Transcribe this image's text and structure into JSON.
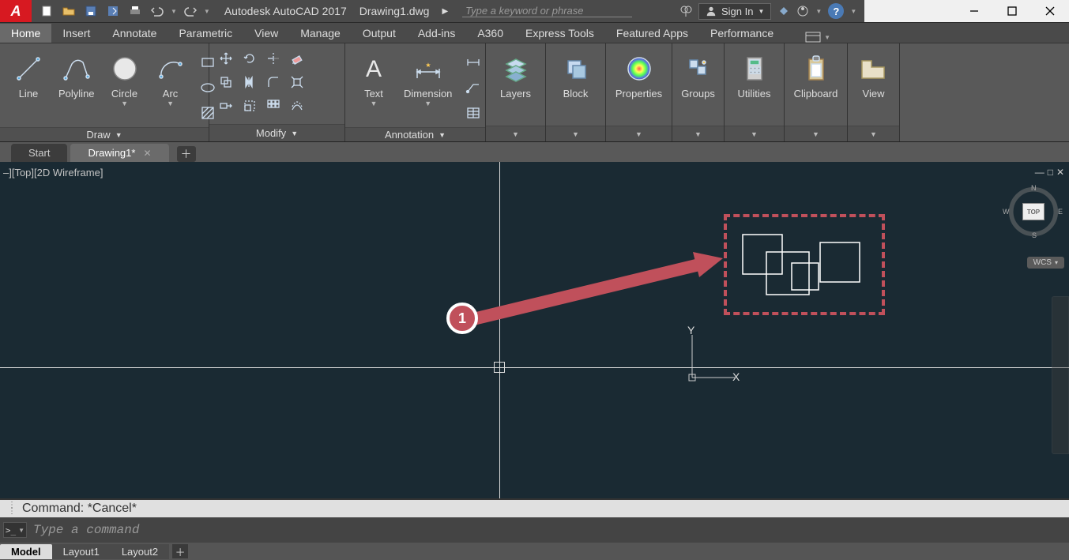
{
  "title": {
    "app_name": "Autodesk AutoCAD 2017",
    "file_name": "Drawing1.dwg"
  },
  "search": {
    "placeholder": "Type a keyword or phrase"
  },
  "signin": {
    "label": "Sign In"
  },
  "ribbon_tabs": [
    "Home",
    "Insert",
    "Annotate",
    "Parametric",
    "View",
    "Manage",
    "Output",
    "Add-ins",
    "A360",
    "Express Tools",
    "Featured Apps",
    "Performance"
  ],
  "panels": {
    "draw": {
      "footer": "Draw",
      "buttons": {
        "line": "Line",
        "polyline": "Polyline",
        "circle": "Circle",
        "arc": "Arc"
      }
    },
    "modify": {
      "footer": "Modify"
    },
    "annotation": {
      "footer": "Annotation",
      "buttons": {
        "text": "Text",
        "dimension": "Dimension"
      }
    },
    "layers": {
      "footer": "",
      "button": "Layers"
    },
    "block": {
      "button": "Block"
    },
    "properties": {
      "button": "Properties"
    },
    "groups": {
      "button": "Groups"
    },
    "utilities": {
      "button": "Utilities"
    },
    "clipboard": {
      "button": "Clipboard"
    },
    "view": {
      "button": "View"
    }
  },
  "file_tabs": {
    "start": "Start",
    "active": "Drawing1*"
  },
  "viewport": {
    "label": "–][Top][2D Wireframe]",
    "ucs_y": "Y",
    "ucs_x": "X",
    "cube_face": "TOP",
    "cube_n": "N",
    "cube_e": "E",
    "cube_s": "S",
    "cube_w": "W",
    "wcs": "WCS"
  },
  "callout": {
    "number": "1"
  },
  "command": {
    "history": "Command: *Cancel*",
    "placeholder": "Type a command"
  },
  "layout_tabs": {
    "model": "Model",
    "l1": "Layout1",
    "l2": "Layout2"
  }
}
